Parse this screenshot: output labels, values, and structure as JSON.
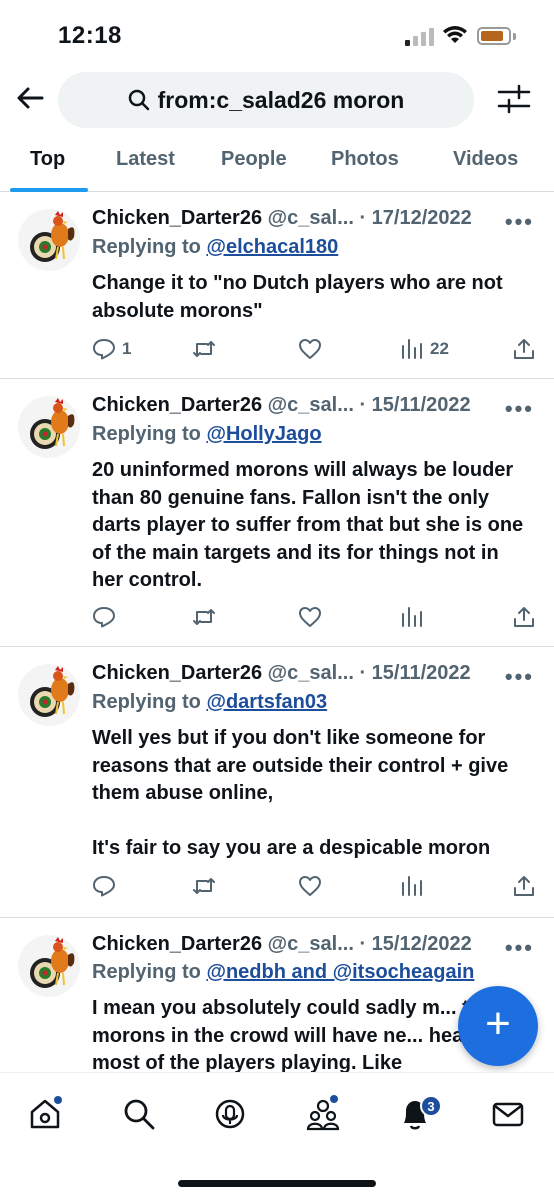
{
  "status": {
    "time": "12:18",
    "battery_color": "#b5651d"
  },
  "search": {
    "query": "from:c_salad26 moron"
  },
  "tabs": [
    {
      "label": "Top",
      "active": true
    },
    {
      "label": "Latest"
    },
    {
      "label": "People"
    },
    {
      "label": "Photos"
    },
    {
      "label": "Videos"
    }
  ],
  "tweets": [
    {
      "name": "Chicken_Darter26",
      "handle": "@c_sal...",
      "date": "· 17/12/2022",
      "reply_prefix": "Replying to",
      "reply_to": "@elchacal180",
      "text": "Change it to \"no Dutch players who are not absolute morons\"",
      "replies": "1",
      "views": "22"
    },
    {
      "name": "Chicken_Darter26",
      "handle": "@c_sal...",
      "date": "· 15/11/2022",
      "reply_prefix": "Replying to",
      "reply_to": "@HollyJago",
      "text": "20 uninformed morons will always be louder than 80 genuine fans. Fallon isn't the only darts player to suffer from that but she is one of the main targets and its for things not in her control."
    },
    {
      "name": "Chicken_Darter26",
      "handle": "@c_sal...",
      "date": "· 15/11/2022",
      "reply_prefix": "Replying to",
      "reply_to": "@dartsfan03",
      "text": "Well yes but if you don't like someone for reasons that are outside their control + give them abuse online,\n\nIt's fair to say you are a despicable moron"
    },
    {
      "name": "Chicken_Darter26",
      "handle": "@c_sal...",
      "date": "· 15/12/2022",
      "reply_prefix": "Replying to",
      "reply_to": "@nedbh and @itsocheagain",
      "text": "I mean you absolutely could sadly m... the morons in the crowd will have ne... heard of most of the players playing. Like"
    }
  ],
  "fab": {
    "label": "+"
  },
  "nav": {
    "notifications_badge": "3"
  },
  "colors": {
    "accent": "#1d9bf0",
    "link": "#1d4e9b",
    "fab": "#1d6fe0"
  }
}
